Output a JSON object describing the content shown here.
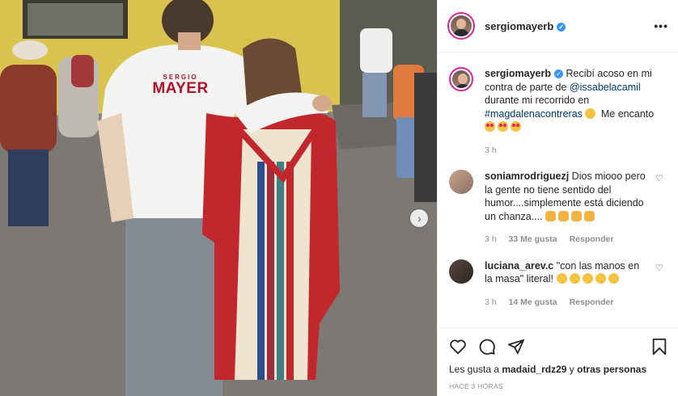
{
  "post": {
    "username": "sergiomayerb",
    "more_label": "•••",
    "shirt_text_top": "SERGIO",
    "shirt_text_main": "MAYER",
    "next_label": "›"
  },
  "caption": {
    "username": "sergiomayerb",
    "text_1": "Recibí acoso en mi contra de parte de ",
    "mention": "@issabelacamil",
    "text_2": " durante mi recorrido en ",
    "hashtag": "#magdalenacontreras",
    "text_3": " Me encanto",
    "time": "3 h"
  },
  "comments": [
    {
      "username": "soniamrodriguezj",
      "text": "Dios miooo pero la gente no tiene sentido del humor....simplemente está diciendo un chanza....",
      "time": "3 h",
      "likes": "33 Me gusta",
      "reply": "Responder"
    },
    {
      "username": "luciana_arev.c",
      "text": "\"con las manos en la masa\" literal!",
      "time": "3 h",
      "likes": "14 Me gusta",
      "reply": "Responder"
    }
  ],
  "footer": {
    "likes_prefix": "Les gusta a ",
    "likes_user": "madaid_rdz29",
    "likes_mid": " y ",
    "likes_others": "otras personas",
    "timestamp": "HACE 3 HORAS"
  },
  "colors": {
    "verified": "#3897f0",
    "link": "#00376b",
    "meta": "#8e8e8e",
    "shirt_text": "#b0122b"
  }
}
